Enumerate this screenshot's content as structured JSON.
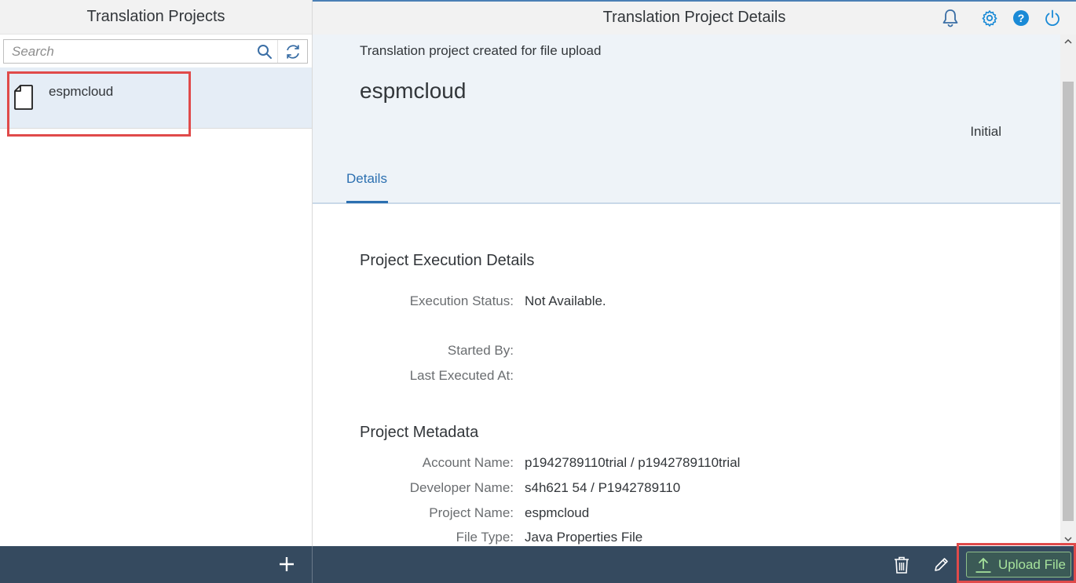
{
  "master": {
    "title": "Translation Projects",
    "search": {
      "placeholder": "Search",
      "value": ""
    },
    "items": [
      {
        "label": "espmcloud",
        "icon": "document-icon"
      }
    ],
    "footer": {
      "add_icon": "plus-icon"
    }
  },
  "detail": {
    "title": "Translation Project Details",
    "header_icons": [
      "bell-icon",
      "gear-icon",
      "help-icon",
      "power-icon"
    ],
    "subtitle": "Translation project created for file upload",
    "object_title": "espmcloud",
    "status": "Initial",
    "tabs": [
      {
        "label": "Details",
        "selected": true
      }
    ],
    "sections": {
      "execution": {
        "title": "Project Execution Details",
        "fields": [
          {
            "label": "Execution Status:",
            "value": "Not Available."
          },
          {
            "label": "Started By:",
            "value": ""
          },
          {
            "label": "Last Executed At:",
            "value": ""
          }
        ]
      },
      "metadata": {
        "title": "Project Metadata",
        "fields": [
          {
            "label": "Account Name:",
            "value": "p1942789110trial / p1942789110trial"
          },
          {
            "label": "Developer Name:",
            "value": "s4h621 54 / P1942789110"
          },
          {
            "label": "Project Name:",
            "value": "espmcloud"
          },
          {
            "label": "File Type:",
            "value": "Java Properties File"
          }
        ]
      }
    },
    "footer": {
      "upload_label": "Upload File",
      "icons": [
        "trash-icon",
        "edit-icon",
        "upload-icon"
      ]
    }
  },
  "colors": {
    "accent": "#2b6fb0",
    "footer_bg": "#354a5f",
    "selected_item_bg": "#e5edf6",
    "highlight": "#e04a4a",
    "upload_text": "#a6e29c"
  }
}
